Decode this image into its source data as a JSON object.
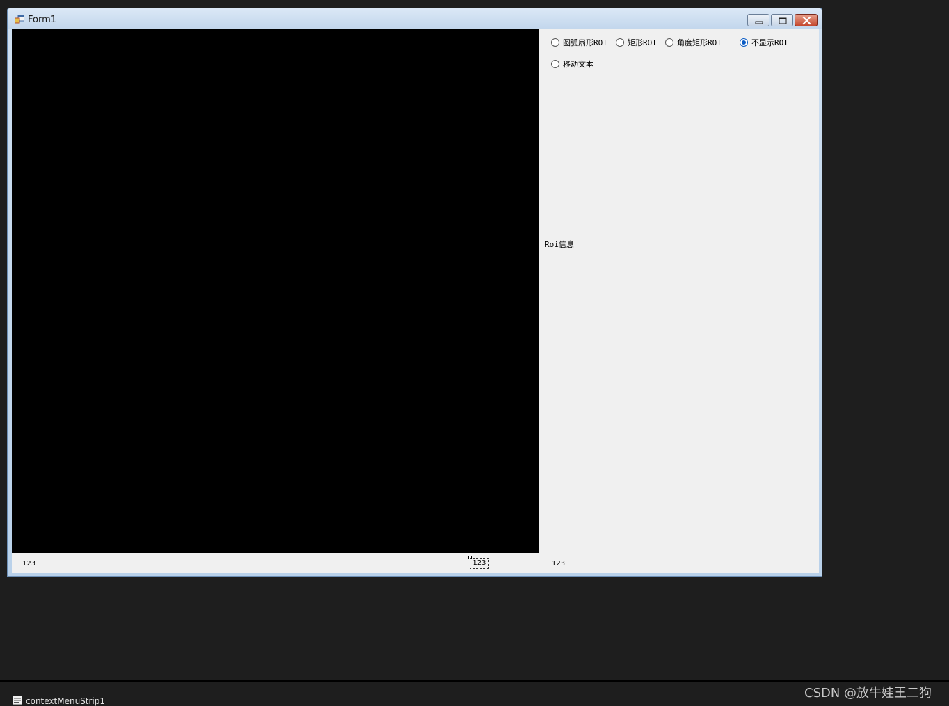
{
  "window": {
    "title": "Form1",
    "icon": "form-app-icon"
  },
  "title_buttons": {
    "minimize_icon": "minimize-icon",
    "maximize_icon": "maximize-icon",
    "close_icon": "close-icon"
  },
  "roi_options": [
    {
      "label": "圆弧扇形ROI",
      "checked": false
    },
    {
      "label": "矩形ROI",
      "checked": false
    },
    {
      "label": "角度矩形ROI",
      "checked": false
    },
    {
      "label": "不显示ROI",
      "checked": true
    },
    {
      "label": "移动文本",
      "checked": false
    }
  ],
  "roi_info_label": "Roi信息",
  "status_labels": {
    "left": "123",
    "middle": "123",
    "right": "123"
  },
  "tray": {
    "component_icon": "context-menu-component-icon",
    "component_name": "contextMenuStrip1"
  },
  "watermark": "CSDN @放牛娃王二狗",
  "colors": {
    "picture_background": "#000000",
    "form_background": "#f0f0f0",
    "radio_checked": "#0a5bc4",
    "designer_background": "#1e1e1e"
  }
}
